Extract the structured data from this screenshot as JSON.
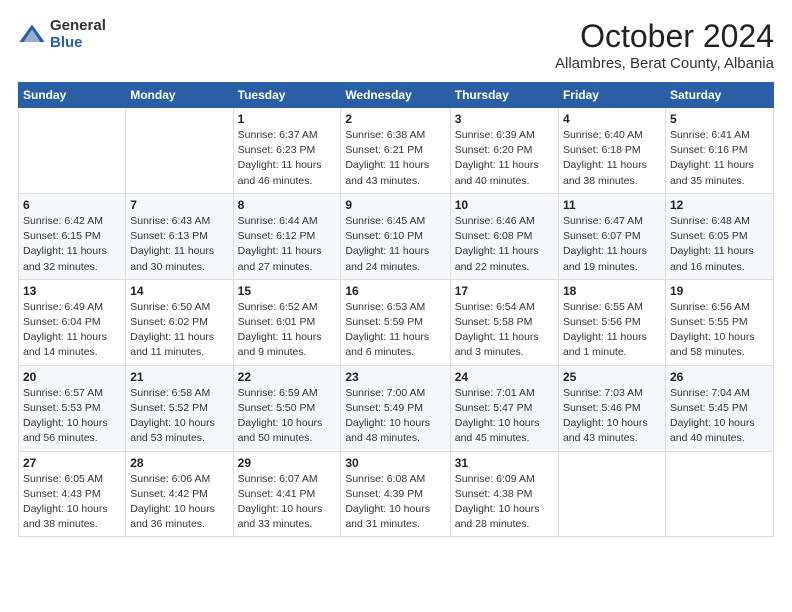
{
  "logo": {
    "general": "General",
    "blue": "Blue"
  },
  "title": "October 2024",
  "location": "Allambres, Berat County, Albania",
  "days_of_week": [
    "Sunday",
    "Monday",
    "Tuesday",
    "Wednesday",
    "Thursday",
    "Friday",
    "Saturday"
  ],
  "weeks": [
    [
      {
        "day": "",
        "info": ""
      },
      {
        "day": "",
        "info": ""
      },
      {
        "day": "1",
        "info": "Sunrise: 6:37 AM\nSunset: 6:23 PM\nDaylight: 11 hours and 46 minutes."
      },
      {
        "day": "2",
        "info": "Sunrise: 6:38 AM\nSunset: 6:21 PM\nDaylight: 11 hours and 43 minutes."
      },
      {
        "day": "3",
        "info": "Sunrise: 6:39 AM\nSunset: 6:20 PM\nDaylight: 11 hours and 40 minutes."
      },
      {
        "day": "4",
        "info": "Sunrise: 6:40 AM\nSunset: 6:18 PM\nDaylight: 11 hours and 38 minutes."
      },
      {
        "day": "5",
        "info": "Sunrise: 6:41 AM\nSunset: 6:16 PM\nDaylight: 11 hours and 35 minutes."
      }
    ],
    [
      {
        "day": "6",
        "info": "Sunrise: 6:42 AM\nSunset: 6:15 PM\nDaylight: 11 hours and 32 minutes."
      },
      {
        "day": "7",
        "info": "Sunrise: 6:43 AM\nSunset: 6:13 PM\nDaylight: 11 hours and 30 minutes."
      },
      {
        "day": "8",
        "info": "Sunrise: 6:44 AM\nSunset: 6:12 PM\nDaylight: 11 hours and 27 minutes."
      },
      {
        "day": "9",
        "info": "Sunrise: 6:45 AM\nSunset: 6:10 PM\nDaylight: 11 hours and 24 minutes."
      },
      {
        "day": "10",
        "info": "Sunrise: 6:46 AM\nSunset: 6:08 PM\nDaylight: 11 hours and 22 minutes."
      },
      {
        "day": "11",
        "info": "Sunrise: 6:47 AM\nSunset: 6:07 PM\nDaylight: 11 hours and 19 minutes."
      },
      {
        "day": "12",
        "info": "Sunrise: 6:48 AM\nSunset: 6:05 PM\nDaylight: 11 hours and 16 minutes."
      }
    ],
    [
      {
        "day": "13",
        "info": "Sunrise: 6:49 AM\nSunset: 6:04 PM\nDaylight: 11 hours and 14 minutes."
      },
      {
        "day": "14",
        "info": "Sunrise: 6:50 AM\nSunset: 6:02 PM\nDaylight: 11 hours and 11 minutes."
      },
      {
        "day": "15",
        "info": "Sunrise: 6:52 AM\nSunset: 6:01 PM\nDaylight: 11 hours and 9 minutes."
      },
      {
        "day": "16",
        "info": "Sunrise: 6:53 AM\nSunset: 5:59 PM\nDaylight: 11 hours and 6 minutes."
      },
      {
        "day": "17",
        "info": "Sunrise: 6:54 AM\nSunset: 5:58 PM\nDaylight: 11 hours and 3 minutes."
      },
      {
        "day": "18",
        "info": "Sunrise: 6:55 AM\nSunset: 5:56 PM\nDaylight: 11 hours and 1 minute."
      },
      {
        "day": "19",
        "info": "Sunrise: 6:56 AM\nSunset: 5:55 PM\nDaylight: 10 hours and 58 minutes."
      }
    ],
    [
      {
        "day": "20",
        "info": "Sunrise: 6:57 AM\nSunset: 5:53 PM\nDaylight: 10 hours and 56 minutes."
      },
      {
        "day": "21",
        "info": "Sunrise: 6:58 AM\nSunset: 5:52 PM\nDaylight: 10 hours and 53 minutes."
      },
      {
        "day": "22",
        "info": "Sunrise: 6:59 AM\nSunset: 5:50 PM\nDaylight: 10 hours and 50 minutes."
      },
      {
        "day": "23",
        "info": "Sunrise: 7:00 AM\nSunset: 5:49 PM\nDaylight: 10 hours and 48 minutes."
      },
      {
        "day": "24",
        "info": "Sunrise: 7:01 AM\nSunset: 5:47 PM\nDaylight: 10 hours and 45 minutes."
      },
      {
        "day": "25",
        "info": "Sunrise: 7:03 AM\nSunset: 5:46 PM\nDaylight: 10 hours and 43 minutes."
      },
      {
        "day": "26",
        "info": "Sunrise: 7:04 AM\nSunset: 5:45 PM\nDaylight: 10 hours and 40 minutes."
      }
    ],
    [
      {
        "day": "27",
        "info": "Sunrise: 6:05 AM\nSunset: 4:43 PM\nDaylight: 10 hours and 38 minutes."
      },
      {
        "day": "28",
        "info": "Sunrise: 6:06 AM\nSunset: 4:42 PM\nDaylight: 10 hours and 36 minutes."
      },
      {
        "day": "29",
        "info": "Sunrise: 6:07 AM\nSunset: 4:41 PM\nDaylight: 10 hours and 33 minutes."
      },
      {
        "day": "30",
        "info": "Sunrise: 6:08 AM\nSunset: 4:39 PM\nDaylight: 10 hours and 31 minutes."
      },
      {
        "day": "31",
        "info": "Sunrise: 6:09 AM\nSunset: 4:38 PM\nDaylight: 10 hours and 28 minutes."
      },
      {
        "day": "",
        "info": ""
      },
      {
        "day": "",
        "info": ""
      }
    ]
  ]
}
